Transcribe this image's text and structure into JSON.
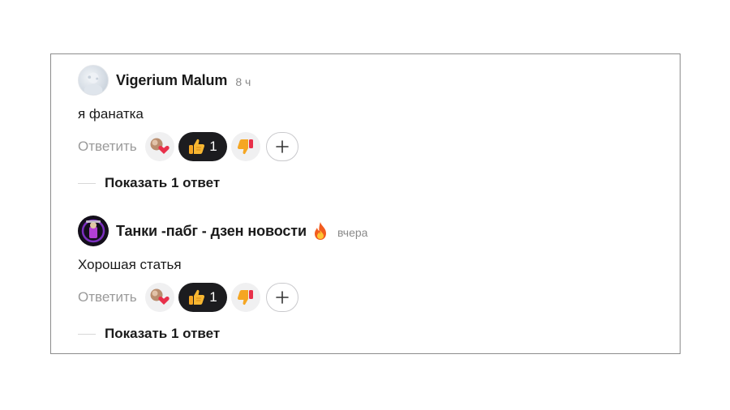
{
  "comments": [
    {
      "author": "Vigerium Malum",
      "time": "8 ч",
      "text": "я фанатка",
      "reply_label": "Ответить",
      "like_count": "1",
      "show_replies_label": "Показать 1 ответ",
      "has_fire_badge": false
    },
    {
      "author": "Танки -пабг - дзен новости",
      "time": "вчера",
      "text": "Хорошая статья",
      "reply_label": "Ответить",
      "like_count": "1",
      "show_replies_label": "Показать 1 ответ",
      "has_fire_badge": true
    }
  ],
  "icons": {
    "reaction_heart": "heart-reaction-icon",
    "like": "thumbs-up-icon",
    "dislike": "thumbs-down-icon",
    "add_reaction": "plus-icon",
    "badge": "fire-icon"
  },
  "colors": {
    "like_pill_bg": "#1c1c1f",
    "grey_pill_bg": "#f0f0f1",
    "muted_text": "#9a9a9a",
    "thumb": "#f5a623",
    "heart": "#e8304a"
  }
}
